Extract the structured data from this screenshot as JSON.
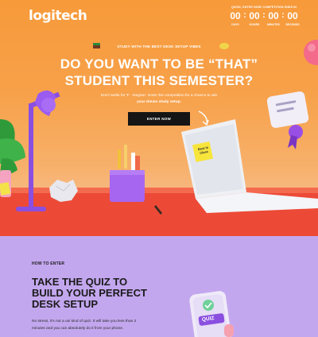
{
  "brand": {
    "logo_text": "logitech"
  },
  "countdown": {
    "caption": "QUICK, ENTER NOW! COMPETITION ENDS IN",
    "units": [
      {
        "value": "00",
        "label": "DAYS"
      },
      {
        "value": "00",
        "label": "HOURS"
      },
      {
        "value": "00",
        "label": "MINUTES"
      },
      {
        "value": "00",
        "label": "SECONDS"
      }
    ]
  },
  "hero": {
    "tagline": "STUDY WITH THE BEST DESK SETUP VIBES",
    "headline_line1": "DO YOU WANT TO BE “THAT”",
    "headline_line2": "STUDENT THIS SEMESTER?",
    "subcopy_line1": "Don't settle for 'F - Degree'. Enter the competition for a chance to win",
    "subcopy_line2": "your dream study setup.",
    "cta_label": "ENTER NOW",
    "sticky_note_text": "Best in Class"
  },
  "how_to_enter": {
    "label": "HOW TO ENTER",
    "heading_line1": "TAKE THE QUIZ TO",
    "heading_line2": "BUILD YOUR PERFECT",
    "heading_line3": "DESK SETUP",
    "body_line1": "No stress, it's not a uni kind of quiz. It will take you less than 2",
    "body_line2": "minutes and you can absolutely do it from your phone.",
    "phone_label": "QUIZ"
  },
  "colors": {
    "hero_orange": "#f79a3a",
    "desk_red": "#f2553a",
    "section_lavender": "#c3a7ee",
    "cta_black": "#151515"
  }
}
